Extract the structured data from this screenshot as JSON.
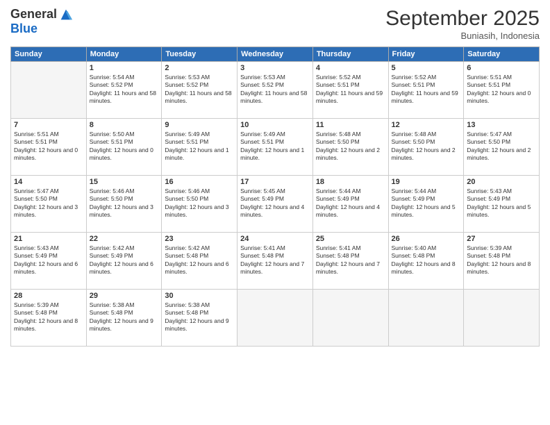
{
  "logo": {
    "line1": "General",
    "line2": "Blue"
  },
  "title": "September 2025",
  "location": "Buniasih, Indonesia",
  "days": [
    "Sunday",
    "Monday",
    "Tuesday",
    "Wednesday",
    "Thursday",
    "Friday",
    "Saturday"
  ],
  "weeks": [
    [
      {
        "day": "",
        "sunrise": "",
        "sunset": "",
        "daylight": ""
      },
      {
        "day": "1",
        "sunrise": "Sunrise: 5:54 AM",
        "sunset": "Sunset: 5:52 PM",
        "daylight": "Daylight: 11 hours and 58 minutes."
      },
      {
        "day": "2",
        "sunrise": "Sunrise: 5:53 AM",
        "sunset": "Sunset: 5:52 PM",
        "daylight": "Daylight: 11 hours and 58 minutes."
      },
      {
        "day": "3",
        "sunrise": "Sunrise: 5:53 AM",
        "sunset": "Sunset: 5:52 PM",
        "daylight": "Daylight: 11 hours and 58 minutes."
      },
      {
        "day": "4",
        "sunrise": "Sunrise: 5:52 AM",
        "sunset": "Sunset: 5:51 PM",
        "daylight": "Daylight: 11 hours and 59 minutes."
      },
      {
        "day": "5",
        "sunrise": "Sunrise: 5:52 AM",
        "sunset": "Sunset: 5:51 PM",
        "daylight": "Daylight: 11 hours and 59 minutes."
      },
      {
        "day": "6",
        "sunrise": "Sunrise: 5:51 AM",
        "sunset": "Sunset: 5:51 PM",
        "daylight": "Daylight: 12 hours and 0 minutes."
      }
    ],
    [
      {
        "day": "7",
        "sunrise": "Sunrise: 5:51 AM",
        "sunset": "Sunset: 5:51 PM",
        "daylight": "Daylight: 12 hours and 0 minutes."
      },
      {
        "day": "8",
        "sunrise": "Sunrise: 5:50 AM",
        "sunset": "Sunset: 5:51 PM",
        "daylight": "Daylight: 12 hours and 0 minutes."
      },
      {
        "day": "9",
        "sunrise": "Sunrise: 5:49 AM",
        "sunset": "Sunset: 5:51 PM",
        "daylight": "Daylight: 12 hours and 1 minute."
      },
      {
        "day": "10",
        "sunrise": "Sunrise: 5:49 AM",
        "sunset": "Sunset: 5:51 PM",
        "daylight": "Daylight: 12 hours and 1 minute."
      },
      {
        "day": "11",
        "sunrise": "Sunrise: 5:48 AM",
        "sunset": "Sunset: 5:50 PM",
        "daylight": "Daylight: 12 hours and 2 minutes."
      },
      {
        "day": "12",
        "sunrise": "Sunrise: 5:48 AM",
        "sunset": "Sunset: 5:50 PM",
        "daylight": "Daylight: 12 hours and 2 minutes."
      },
      {
        "day": "13",
        "sunrise": "Sunrise: 5:47 AM",
        "sunset": "Sunset: 5:50 PM",
        "daylight": "Daylight: 12 hours and 2 minutes."
      }
    ],
    [
      {
        "day": "14",
        "sunrise": "Sunrise: 5:47 AM",
        "sunset": "Sunset: 5:50 PM",
        "daylight": "Daylight: 12 hours and 3 minutes."
      },
      {
        "day": "15",
        "sunrise": "Sunrise: 5:46 AM",
        "sunset": "Sunset: 5:50 PM",
        "daylight": "Daylight: 12 hours and 3 minutes."
      },
      {
        "day": "16",
        "sunrise": "Sunrise: 5:46 AM",
        "sunset": "Sunset: 5:50 PM",
        "daylight": "Daylight: 12 hours and 3 minutes."
      },
      {
        "day": "17",
        "sunrise": "Sunrise: 5:45 AM",
        "sunset": "Sunset: 5:49 PM",
        "daylight": "Daylight: 12 hours and 4 minutes."
      },
      {
        "day": "18",
        "sunrise": "Sunrise: 5:44 AM",
        "sunset": "Sunset: 5:49 PM",
        "daylight": "Daylight: 12 hours and 4 minutes."
      },
      {
        "day": "19",
        "sunrise": "Sunrise: 5:44 AM",
        "sunset": "Sunset: 5:49 PM",
        "daylight": "Daylight: 12 hours and 5 minutes."
      },
      {
        "day": "20",
        "sunrise": "Sunrise: 5:43 AM",
        "sunset": "Sunset: 5:49 PM",
        "daylight": "Daylight: 12 hours and 5 minutes."
      }
    ],
    [
      {
        "day": "21",
        "sunrise": "Sunrise: 5:43 AM",
        "sunset": "Sunset: 5:49 PM",
        "daylight": "Daylight: 12 hours and 6 minutes."
      },
      {
        "day": "22",
        "sunrise": "Sunrise: 5:42 AM",
        "sunset": "Sunset: 5:49 PM",
        "daylight": "Daylight: 12 hours and 6 minutes."
      },
      {
        "day": "23",
        "sunrise": "Sunrise: 5:42 AM",
        "sunset": "Sunset: 5:48 PM",
        "daylight": "Daylight: 12 hours and 6 minutes."
      },
      {
        "day": "24",
        "sunrise": "Sunrise: 5:41 AM",
        "sunset": "Sunset: 5:48 PM",
        "daylight": "Daylight: 12 hours and 7 minutes."
      },
      {
        "day": "25",
        "sunrise": "Sunrise: 5:41 AM",
        "sunset": "Sunset: 5:48 PM",
        "daylight": "Daylight: 12 hours and 7 minutes."
      },
      {
        "day": "26",
        "sunrise": "Sunrise: 5:40 AM",
        "sunset": "Sunset: 5:48 PM",
        "daylight": "Daylight: 12 hours and 8 minutes."
      },
      {
        "day": "27",
        "sunrise": "Sunrise: 5:39 AM",
        "sunset": "Sunset: 5:48 PM",
        "daylight": "Daylight: 12 hours and 8 minutes."
      }
    ],
    [
      {
        "day": "28",
        "sunrise": "Sunrise: 5:39 AM",
        "sunset": "Sunset: 5:48 PM",
        "daylight": "Daylight: 12 hours and 8 minutes."
      },
      {
        "day": "29",
        "sunrise": "Sunrise: 5:38 AM",
        "sunset": "Sunset: 5:48 PM",
        "daylight": "Daylight: 12 hours and 9 minutes."
      },
      {
        "day": "30",
        "sunrise": "Sunrise: 5:38 AM",
        "sunset": "Sunset: 5:48 PM",
        "daylight": "Daylight: 12 hours and 9 minutes."
      },
      {
        "day": "",
        "sunrise": "",
        "sunset": "",
        "daylight": ""
      },
      {
        "day": "",
        "sunrise": "",
        "sunset": "",
        "daylight": ""
      },
      {
        "day": "",
        "sunrise": "",
        "sunset": "",
        "daylight": ""
      },
      {
        "day": "",
        "sunrise": "",
        "sunset": "",
        "daylight": ""
      }
    ]
  ]
}
